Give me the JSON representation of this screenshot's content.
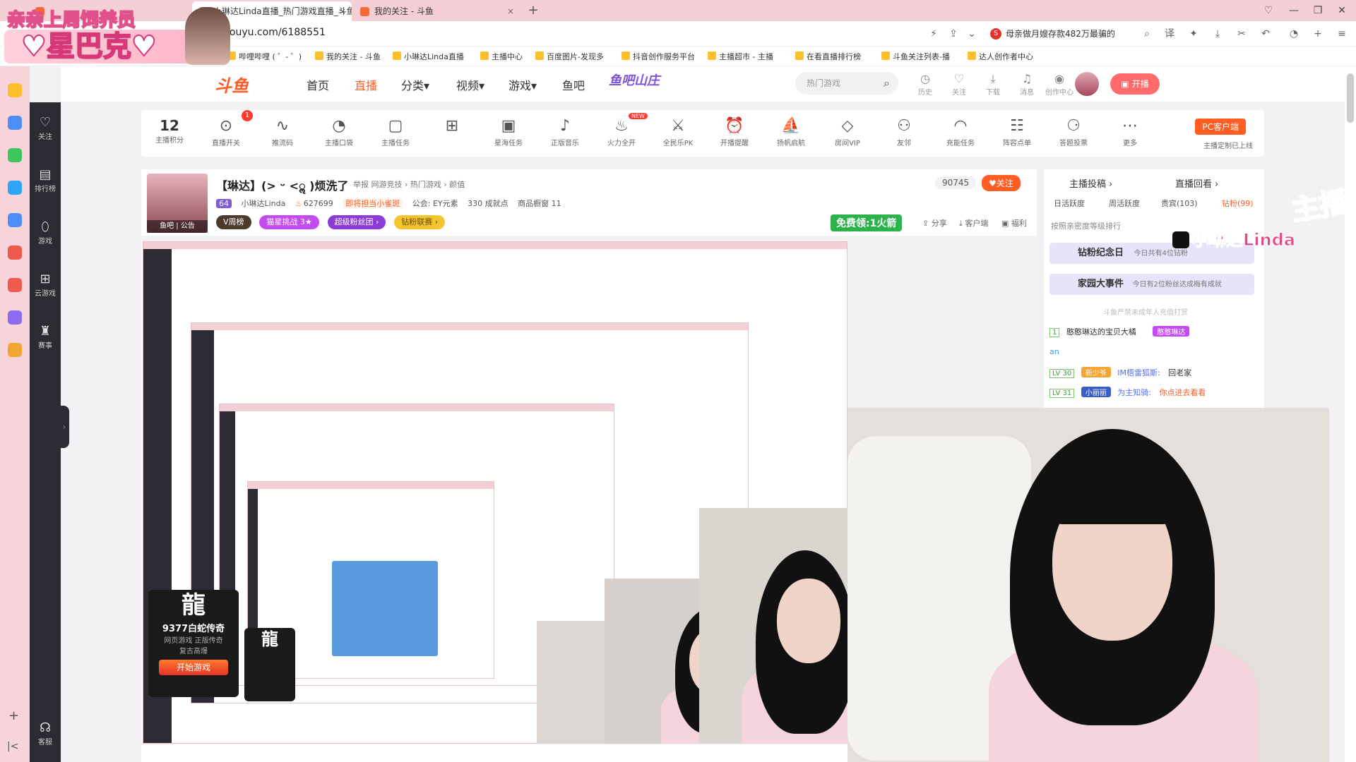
{
  "browser": {
    "tabs": [
      {
        "label": "小琳达Linda直播_热门游戏直播_斗鱼",
        "active": true
      },
      {
        "label": "我的关注 - 斗鱼",
        "active": false
      }
    ],
    "new_tab": "+",
    "url": "douyu.com/6188551",
    "omni_search": "母亲做月嫂存款482万最骗的",
    "bookmarks": [
      "哔哩哔哩 ( ゜- ゜)",
      "我的关注 - 斗鱼",
      "小琳达Linda直播",
      "主播中心",
      "百度图片-发现多",
      "抖音创作服务平台",
      "主播超市 - 主播",
      "在看直播排行榜",
      "斗鱼关注列表-播",
      "达人创作者中心"
    ]
  },
  "overlay": {
    "line1": "亲亲上周饲养员",
    "line2": "♥星巴克♥"
  },
  "sidebar": {
    "items": [
      {
        "icon": "heart-icon",
        "label": "关注"
      },
      {
        "icon": "ranking-icon",
        "label": "排行榜"
      },
      {
        "icon": "game-icon",
        "label": "游戏"
      },
      {
        "icon": "cloud-game-icon",
        "label": "云游戏"
      },
      {
        "icon": "trophy-icon",
        "label": "赛事"
      },
      {
        "icon": "support-icon",
        "label": "客服"
      }
    ],
    "add": "+",
    "collapse": "|<"
  },
  "header": {
    "logo": "斗鱼",
    "nav": [
      {
        "label": "首页",
        "active": false
      },
      {
        "label": "直播",
        "active": true
      },
      {
        "label": "分类▾",
        "active": false
      },
      {
        "label": "视频▾",
        "active": false
      },
      {
        "label": "游戏▾",
        "active": false
      },
      {
        "label": "鱼吧",
        "active": false
      }
    ],
    "event_logo": "鱼吧山庄",
    "search_placeholder": "热门游戏",
    "icons": [
      {
        "icon": "history-icon",
        "label": "历史"
      },
      {
        "icon": "follow-icon",
        "label": "关注"
      },
      {
        "icon": "download-icon",
        "label": "下载"
      },
      {
        "icon": "bell-icon",
        "label": "消息"
      },
      {
        "icon": "creator-icon",
        "label": "创作中心"
      }
    ],
    "live_button": "开播"
  },
  "toolbar": {
    "score": "12",
    "score_label": "主播积分",
    "badge": "1",
    "new_tag": "NEW",
    "items": [
      "直播开关",
      "推流码",
      "主播口袋",
      "主播任务",
      "",
      "星海任务",
      "正版音乐",
      "火力全开",
      "全民乐PK",
      "开播提醒",
      "扬帆启航",
      "房间VIP",
      "友邻",
      "充能任务",
      "阵容点单",
      "答题投票",
      "更多"
    ],
    "pc_client": "PC客户端",
    "pc_sub": "主播定制已上线"
  },
  "room": {
    "title": "【琳达】(> ᵕ <ॢ )烦洗了",
    "report": "举报",
    "crumb": "网游竞技 › 热门游戏 › 颜值",
    "level": "64",
    "anchor": "小琳达Linda",
    "hot": "627699",
    "fan_badge": "即将担当小雀斑",
    "guild": "公会: EY元素",
    "achievements": "330 成就点",
    "shop": "商品橱窗 11",
    "avatar_tags": "鱼吧 | 公告",
    "pills": [
      "V周榜",
      "猫星挑战 3★",
      "超级粉丝团 ›",
      "钻粉联赛 ›"
    ],
    "viewers": "90745",
    "follow": "♥关注",
    "free_gift": "免费领:1火箭",
    "actions": [
      "分享",
      "客户端",
      "福利"
    ]
  },
  "chatpanel": {
    "tabs": [
      "主播投稿 ›",
      "直播回看 ›"
    ],
    "subtabs": [
      {
        "label": "日活跃度",
        "on": false
      },
      {
        "label": "周活跃度",
        "on": false
      },
      {
        "label": "贵宾(103)",
        "on": false
      },
      {
        "label": "钻粉(99)",
        "on": true
      }
    ],
    "rank_hint": "按照亲密度等级排行",
    "anniv": "钻粉纪念日",
    "anniv_sub": "今日共有4位钻粉",
    "event": "家园大事件",
    "event_sub": "今日有2位粉丝达成梅有成就",
    "notice": "斗鱼严禁未成年人充值打赏",
    "fan_rank": "1",
    "fan_name": "憨憨琳达的宝贝大橘",
    "fan_chip": "憨憨琳达",
    "chat": [
      {
        "level": "LV 30",
        "badge": "新少爷",
        "user": "IM梧雷狐斯:",
        "msg": "回老家"
      },
      {
        "level": "LV 31",
        "badge": "小丽丽",
        "user": "为主知骑:",
        "msg": "你点进去看看"
      }
    ],
    "an": "an"
  },
  "ads": [
    {
      "name": "9377白蛇传奇",
      "tags": "网页游戏 正版传奇",
      "tag2": "复古高爆",
      "btn": "开始游戏"
    }
  ],
  "corner_logo": "主播",
  "douyin_name": "小琳达Linda"
}
